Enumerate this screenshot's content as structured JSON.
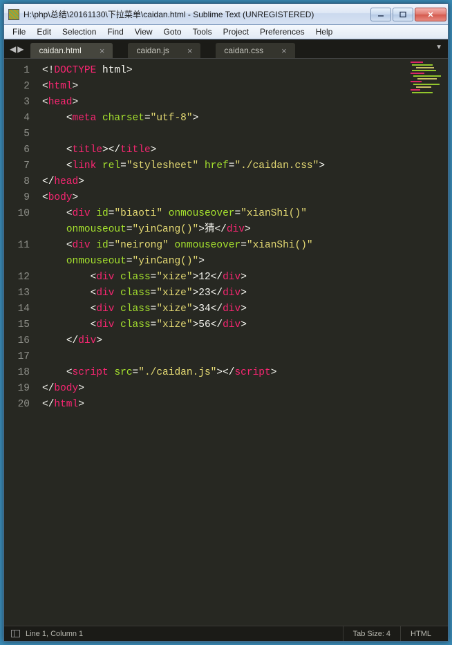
{
  "titlebar": {
    "title": "H:\\php\\总结\\20161130\\下拉菜单\\caidan.html - Sublime Text (UNREGISTERED)"
  },
  "menubar": {
    "items": [
      "File",
      "Edit",
      "Selection",
      "Find",
      "View",
      "Goto",
      "Tools",
      "Project",
      "Preferences",
      "Help"
    ]
  },
  "tabs": [
    {
      "label": "caidan.html",
      "active": true
    },
    {
      "label": "caidan.js",
      "active": false
    },
    {
      "label": "caidan.css",
      "active": false
    }
  ],
  "editor": {
    "line_numbers": [
      "1",
      "2",
      "3",
      "4",
      "5",
      "6",
      "7",
      "8",
      "9",
      "10",
      "11",
      "12",
      "13",
      "14",
      "15",
      "16",
      "17",
      "18",
      "19",
      "20"
    ],
    "lines": [
      [
        {
          "c": "p-punc",
          "t": "<!"
        },
        {
          "c": "p-doc",
          "t": "DOCTYPE"
        },
        {
          "c": "p-text",
          "t": " html"
        },
        {
          "c": "p-punc",
          "t": ">"
        }
      ],
      [
        {
          "c": "p-punc",
          "t": "<"
        },
        {
          "c": "p-tag",
          "t": "html"
        },
        {
          "c": "p-punc",
          "t": ">"
        }
      ],
      [
        {
          "c": "p-punc",
          "t": "<"
        },
        {
          "c": "p-tag",
          "t": "head"
        },
        {
          "c": "p-punc",
          "t": ">"
        }
      ],
      [
        {
          "c": "p-text",
          "t": "    "
        },
        {
          "c": "p-punc",
          "t": "<"
        },
        {
          "c": "p-tag",
          "t": "meta"
        },
        {
          "c": "p-text",
          "t": " "
        },
        {
          "c": "p-attr",
          "t": "charset"
        },
        {
          "c": "p-punc",
          "t": "="
        },
        {
          "c": "p-str",
          "t": "\"utf-8\""
        },
        {
          "c": "p-punc",
          "t": ">"
        }
      ],
      [
        {
          "c": "p-text",
          "t": ""
        }
      ],
      [
        {
          "c": "p-text",
          "t": "    "
        },
        {
          "c": "p-punc",
          "t": "<"
        },
        {
          "c": "p-tag",
          "t": "title"
        },
        {
          "c": "p-punc",
          "t": "></"
        },
        {
          "c": "p-tag",
          "t": "title"
        },
        {
          "c": "p-punc",
          "t": ">"
        }
      ],
      [
        {
          "c": "p-text",
          "t": "    "
        },
        {
          "c": "p-punc",
          "t": "<"
        },
        {
          "c": "p-tag",
          "t": "link"
        },
        {
          "c": "p-text",
          "t": " "
        },
        {
          "c": "p-attr",
          "t": "rel"
        },
        {
          "c": "p-punc",
          "t": "="
        },
        {
          "c": "p-str",
          "t": "\"stylesheet\""
        },
        {
          "c": "p-text",
          "t": " "
        },
        {
          "c": "p-attr",
          "t": "href"
        },
        {
          "c": "p-punc",
          "t": "="
        },
        {
          "c": "p-str",
          "t": "\"./caidan.css\""
        },
        {
          "c": "p-punc",
          "t": ">"
        }
      ],
      [
        {
          "c": "p-punc",
          "t": "</"
        },
        {
          "c": "p-tag",
          "t": "head"
        },
        {
          "c": "p-punc",
          "t": ">"
        }
      ],
      [
        {
          "c": "p-punc",
          "t": "<"
        },
        {
          "c": "p-tag",
          "t": "body"
        },
        {
          "c": "p-punc",
          "t": ">"
        }
      ],
      [
        {
          "c": "p-text",
          "t": "    "
        },
        {
          "c": "p-punc",
          "t": "<"
        },
        {
          "c": "p-tag",
          "t": "div"
        },
        {
          "c": "p-text",
          "t": " "
        },
        {
          "c": "p-attr",
          "t": "id"
        },
        {
          "c": "p-punc",
          "t": "="
        },
        {
          "c": "p-str",
          "t": "\"biaoti\""
        },
        {
          "c": "p-text",
          "t": " "
        },
        {
          "c": "p-attr",
          "t": "onmouseover"
        },
        {
          "c": "p-punc",
          "t": "="
        },
        {
          "c": "p-str",
          "t": "\"xianShi()\""
        },
        {
          "c": "p-text",
          "t": " "
        },
        {
          "c": "p-attr",
          "t": "onmouseout"
        },
        {
          "c": "p-punc",
          "t": "="
        },
        {
          "c": "p-str",
          "t": "\"yinCang()\""
        },
        {
          "c": "p-punc",
          "t": ">"
        },
        {
          "c": "p-text",
          "t": "猜"
        },
        {
          "c": "p-punc",
          "t": "</"
        },
        {
          "c": "p-tag",
          "t": "div"
        },
        {
          "c": "p-punc",
          "t": ">"
        }
      ],
      [
        {
          "c": "p-text",
          "t": "    "
        },
        {
          "c": "p-punc",
          "t": "<"
        },
        {
          "c": "p-tag",
          "t": "div"
        },
        {
          "c": "p-text",
          "t": " "
        },
        {
          "c": "p-attr",
          "t": "id"
        },
        {
          "c": "p-punc",
          "t": "="
        },
        {
          "c": "p-str",
          "t": "\"neirong\""
        },
        {
          "c": "p-text",
          "t": " "
        },
        {
          "c": "p-attr",
          "t": "onmouseover"
        },
        {
          "c": "p-punc",
          "t": "="
        },
        {
          "c": "p-str",
          "t": "\"xianShi()\""
        },
        {
          "c": "p-text",
          "t": " "
        },
        {
          "c": "p-attr",
          "t": "onmouseout"
        },
        {
          "c": "p-punc",
          "t": "="
        },
        {
          "c": "p-str",
          "t": "\"yinCang()\""
        },
        {
          "c": "p-punc",
          "t": ">"
        }
      ],
      [
        {
          "c": "p-text",
          "t": "        "
        },
        {
          "c": "p-punc",
          "t": "<"
        },
        {
          "c": "p-tag",
          "t": "div"
        },
        {
          "c": "p-text",
          "t": " "
        },
        {
          "c": "p-attr",
          "t": "class"
        },
        {
          "c": "p-punc",
          "t": "="
        },
        {
          "c": "p-str",
          "t": "\"xize\""
        },
        {
          "c": "p-punc",
          "t": ">"
        },
        {
          "c": "p-text",
          "t": "12"
        },
        {
          "c": "p-punc",
          "t": "</"
        },
        {
          "c": "p-tag",
          "t": "div"
        },
        {
          "c": "p-punc",
          "t": ">"
        }
      ],
      [
        {
          "c": "p-text",
          "t": "        "
        },
        {
          "c": "p-punc",
          "t": "<"
        },
        {
          "c": "p-tag",
          "t": "div"
        },
        {
          "c": "p-text",
          "t": " "
        },
        {
          "c": "p-attr",
          "t": "class"
        },
        {
          "c": "p-punc",
          "t": "="
        },
        {
          "c": "p-str",
          "t": "\"xize\""
        },
        {
          "c": "p-punc",
          "t": ">"
        },
        {
          "c": "p-text",
          "t": "23"
        },
        {
          "c": "p-punc",
          "t": "</"
        },
        {
          "c": "p-tag",
          "t": "div"
        },
        {
          "c": "p-punc",
          "t": ">"
        }
      ],
      [
        {
          "c": "p-text",
          "t": "        "
        },
        {
          "c": "p-punc",
          "t": "<"
        },
        {
          "c": "p-tag",
          "t": "div"
        },
        {
          "c": "p-text",
          "t": " "
        },
        {
          "c": "p-attr",
          "t": "class"
        },
        {
          "c": "p-punc",
          "t": "="
        },
        {
          "c": "p-str",
          "t": "\"xize\""
        },
        {
          "c": "p-punc",
          "t": ">"
        },
        {
          "c": "p-text",
          "t": "34"
        },
        {
          "c": "p-punc",
          "t": "</"
        },
        {
          "c": "p-tag",
          "t": "div"
        },
        {
          "c": "p-punc",
          "t": ">"
        }
      ],
      [
        {
          "c": "p-text",
          "t": "        "
        },
        {
          "c": "p-punc",
          "t": "<"
        },
        {
          "c": "p-tag",
          "t": "div"
        },
        {
          "c": "p-text",
          "t": " "
        },
        {
          "c": "p-attr",
          "t": "class"
        },
        {
          "c": "p-punc",
          "t": "="
        },
        {
          "c": "p-str",
          "t": "\"xize\""
        },
        {
          "c": "p-punc",
          "t": ">"
        },
        {
          "c": "p-text",
          "t": "56"
        },
        {
          "c": "p-punc",
          "t": "</"
        },
        {
          "c": "p-tag",
          "t": "div"
        },
        {
          "c": "p-punc",
          "t": ">"
        }
      ],
      [
        {
          "c": "p-text",
          "t": "    "
        },
        {
          "c": "p-punc",
          "t": "</"
        },
        {
          "c": "p-tag",
          "t": "div"
        },
        {
          "c": "p-punc",
          "t": ">"
        }
      ],
      [
        {
          "c": "p-text",
          "t": ""
        }
      ],
      [
        {
          "c": "p-text",
          "t": "    "
        },
        {
          "c": "p-punc",
          "t": "<"
        },
        {
          "c": "p-tag",
          "t": "script"
        },
        {
          "c": "p-text",
          "t": " "
        },
        {
          "c": "p-attr",
          "t": "src"
        },
        {
          "c": "p-punc",
          "t": "="
        },
        {
          "c": "p-str",
          "t": "\"./caidan.js\""
        },
        {
          "c": "p-punc",
          "t": "></"
        },
        {
          "c": "p-tag",
          "t": "script"
        },
        {
          "c": "p-punc",
          "t": ">"
        }
      ],
      [
        {
          "c": "p-punc",
          "t": "</"
        },
        {
          "c": "p-tag",
          "t": "body"
        },
        {
          "c": "p-punc",
          "t": ">"
        }
      ],
      [
        {
          "c": "p-punc",
          "t": "</"
        },
        {
          "c": "p-tag",
          "t": "html"
        },
        {
          "c": "p-punc",
          "t": ">"
        }
      ]
    ],
    "wrap_width_chars": 47
  },
  "statusbar": {
    "position": "Line 1, Column 1",
    "tab_size": "Tab Size: 4",
    "syntax": "HTML"
  }
}
